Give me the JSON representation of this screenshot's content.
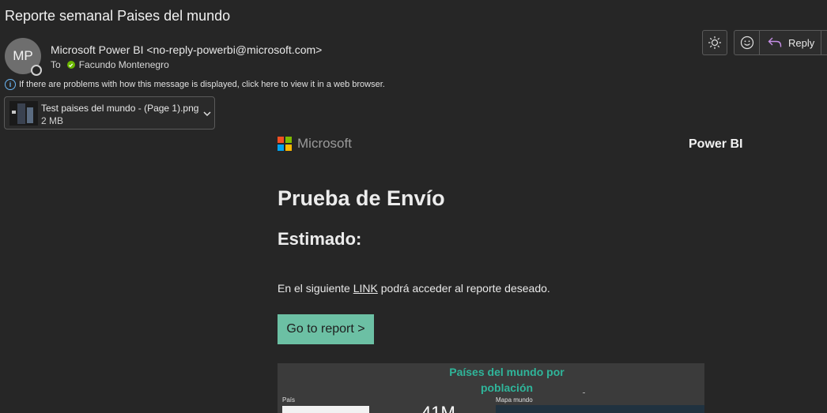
{
  "email": {
    "subject": "Reporte semanal Paises del mundo",
    "avatar_initials": "MP",
    "sender": "Microsoft Power BI <no-reply-powerbi@microsoft.com>",
    "to_label": "To",
    "recipient": "Facundo Montenegro",
    "info_message": "If there are problems with how this message is displayed, click here to view it in a web browser."
  },
  "attachment": {
    "name": "Test paises del mundo - (Page 1).png",
    "size": "2 MB"
  },
  "toolbar": {
    "reply_label": "Reply"
  },
  "body": {
    "logo_text": "Microsoft",
    "product": "Power BI",
    "heading": "Prueba de Envío",
    "greeting": "Estimado:",
    "text_before_link": "En el siguiente ",
    "link_text": "LINK",
    "text_after_link": " podrá acceder al reporte deseado.",
    "button_label": "Go to report >"
  },
  "report_preview": {
    "title_line1": "Países del mundo por",
    "title_line2": "población",
    "filter_label": "País",
    "kpi_value": "41M",
    "map_label": "Mapa mundo"
  },
  "colors": {
    "background": "#262626",
    "button": "#6cc0a4",
    "report_title": "#2fb59a",
    "ms_red": "#f25022",
    "ms_green": "#7fba00",
    "ms_blue": "#00a4ef",
    "ms_yellow": "#ffb900"
  }
}
